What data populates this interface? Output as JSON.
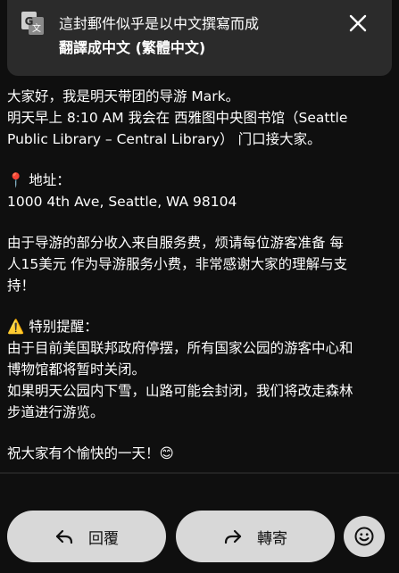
{
  "translation_banner": {
    "line1": "這封郵件似乎是以中文撰寫而成",
    "line2": "翻譯成中文 (繁體中文)",
    "icon": "translate-icon",
    "close_icon": "close-icon"
  },
  "message": {
    "paragraph1": [
      "大家好，我是明天带团的导游 Mark。",
      "明天早上 8:10 AM 我会在 西雅图中央图书馆（Seattle",
      "Public Library – Central Library） 门口接大家。"
    ],
    "address_heading": "📍 地址：",
    "address": "1000 4th Ave, Seattle, WA 98104",
    "paragraph3": [
      "由于导游的部分收入来自服务费，烦请每位游客准备 每",
      "人15美元 作为导游服务小费，非常感谢大家的理解与支",
      "持！"
    ],
    "notice_heading": "⚠️ 特别提醒：",
    "notice": [
      "由于目前美国联邦政府停摆，所有国家公园的游客中心和",
      "博物馆都将暂时关闭。",
      "如果明天公园内下雪，山路可能会封闭，我们将改走森林",
      "步道进行游览。"
    ],
    "closing": "祝大家有个愉快的一天！😊"
  },
  "actions": {
    "reply_label": "回覆",
    "forward_label": "轉寄",
    "reply_icon": "reply-arrow-icon",
    "forward_icon": "forward-arrow-icon",
    "emoji_icon": "smiley-icon"
  },
  "colors": {
    "background": "#0f0f0f",
    "banner": "#2b2b2b",
    "button": "#d8d8d8"
  }
}
